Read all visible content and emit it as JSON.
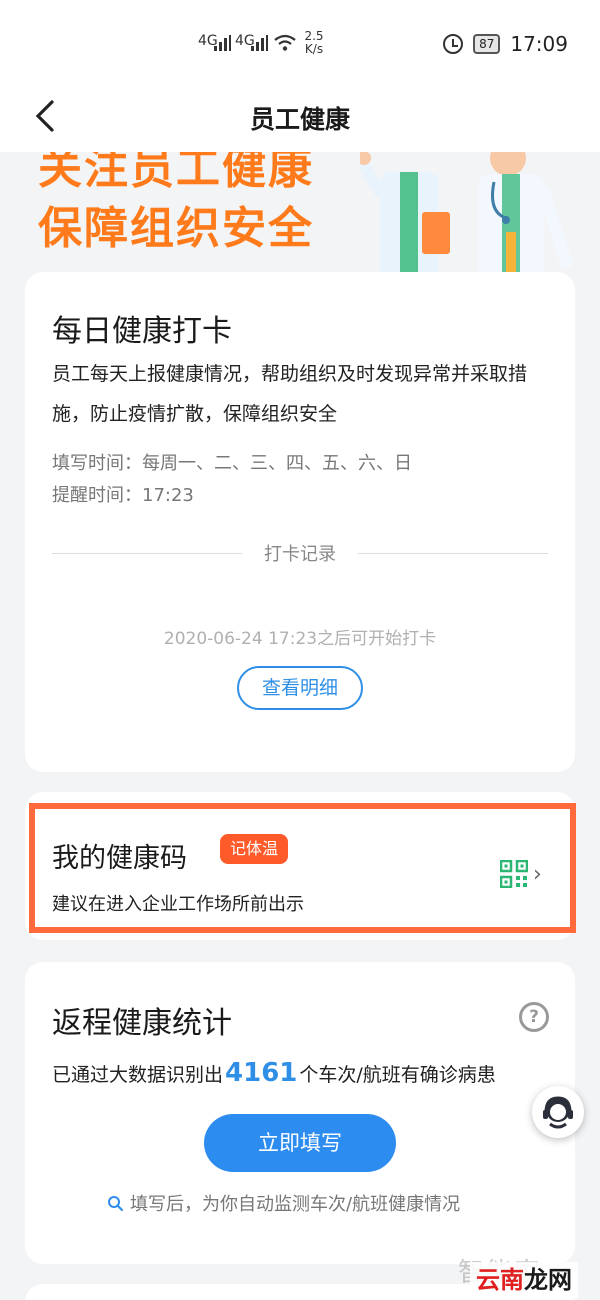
{
  "status_bar": {
    "network_left": "4G",
    "network_right": "4G",
    "speed_value": "2.5",
    "speed_unit": "K/s",
    "battery": "87",
    "time": "17:09",
    "icons": [
      "signal-icon",
      "signal-icon",
      "wifi-icon",
      "alarm-icon",
      "battery-icon"
    ]
  },
  "nav": {
    "title": "员工健康",
    "back_icon": "back-arrow-icon"
  },
  "banner": {
    "line1": "关注员工健康",
    "line2": "保障组织安全",
    "accent_color": "#ff7a1a"
  },
  "daily_checkin": {
    "title": "每日健康打卡",
    "description": "员工每天上报健康情况，帮助组织及时发现异常并采取措施，防止疫情扩散，保障组织安全",
    "fill_time": "填写时间：每周一、二、三、四、五、六、日",
    "remind_time": "提醒时间：17:23",
    "record_title": "打卡记录",
    "hint": "2020-06-24 17:23之后可开始打卡",
    "view_button": "查看明细"
  },
  "health_code": {
    "title": "我的健康码",
    "tag": "记体温",
    "description": "建议在进入企业工作场所前出示",
    "icon": "qr-code-icon",
    "highlight_color": "#ff6a3d"
  },
  "return_stats": {
    "title": "返程健康统计",
    "stats_prefix": "已通过大数据识别出",
    "stats_number": "4161",
    "stats_suffix": "个车次/航班有确诊病患",
    "fill_button": "立即填写",
    "auto_hint": "填写后，为你自动监测车次/航班健康情况"
  },
  "watermark": {
    "text": "智能家",
    "brand_1": "云南",
    "brand_2": "龙网"
  },
  "colors": {
    "primary": "#2d8cf0",
    "tag": "#ff5a2a",
    "qr": "#2bb673"
  }
}
